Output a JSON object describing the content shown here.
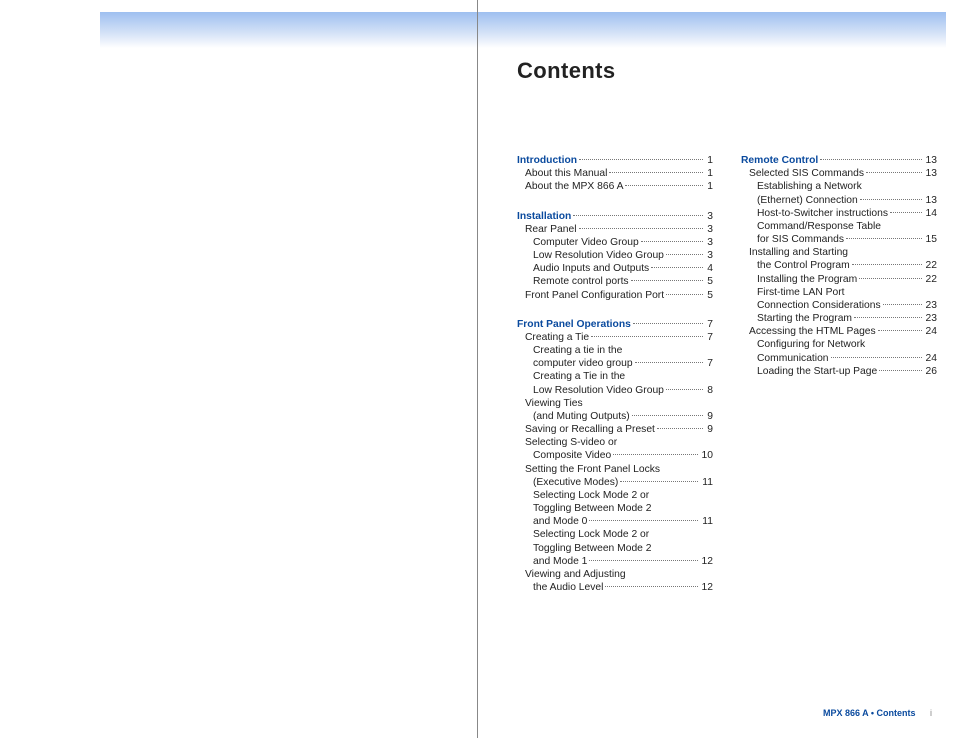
{
  "title": "Contents",
  "footer": {
    "doc": "MPX 866 A • Contents",
    "page": "i"
  },
  "toc": [
    {
      "col": 0,
      "sections": [
        {
          "head": {
            "label": "Introduction",
            "page": "1"
          },
          "items": [
            {
              "label": "About this Manual",
              "page": "1",
              "indent": 1
            },
            {
              "label": "About the MPX 866 A",
              "page": "1",
              "indent": 1
            }
          ]
        },
        {
          "head": {
            "label": "Installation",
            "page": "3"
          },
          "items": [
            {
              "label": "Rear Panel",
              "page": "3",
              "indent": 1
            },
            {
              "label": "Computer Video Group",
              "page": "3",
              "indent": 2
            },
            {
              "label": "Low Resolution Video Group",
              "page": "3",
              "indent": 2
            },
            {
              "label": "Audio Inputs and Outputs",
              "page": "4",
              "indent": 2
            },
            {
              "label": "Remote control ports",
              "page": "5",
              "indent": 2
            },
            {
              "label": "Front Panel Configuration Port",
              "page": "5",
              "indent": 1
            }
          ]
        },
        {
          "head": {
            "label": "Front Panel Operations",
            "page": "7"
          },
          "items": [
            {
              "label": "Creating a Tie",
              "page": "7",
              "indent": 1
            },
            {
              "label": "Creating a tie in the",
              "indent": 2
            },
            {
              "label": "computer video group",
              "page": "7",
              "indent": 2,
              "cont": true
            },
            {
              "label": "Creating a Tie in the",
              "indent": 2
            },
            {
              "label": "Low Resolution Video Group",
              "page": "8",
              "indent": 2,
              "cont": true
            },
            {
              "label": "Viewing Ties",
              "indent": 1
            },
            {
              "label": "(and Muting Outputs)",
              "page": "9",
              "indent": 2,
              "cont": true
            },
            {
              "label": "Saving or Recalling a Preset",
              "page": "9",
              "indent": 1
            },
            {
              "label": "Selecting S-video or",
              "indent": 1
            },
            {
              "label": "Composite Video",
              "page": "10",
              "indent": 2,
              "cont": true
            },
            {
              "label": "Setting the Front Panel Locks",
              "indent": 1
            },
            {
              "label": "(Executive Modes)",
              "page": "11",
              "indent": 2,
              "cont": true
            },
            {
              "label": "Selecting Lock Mode 2 or",
              "indent": 2
            },
            {
              "label": "Toggling Between Mode 2",
              "indent": 2,
              "cont": true
            },
            {
              "label": "and Mode 0",
              "page": "11",
              "indent": 2,
              "cont": true
            },
            {
              "label": "Selecting Lock Mode 2 or",
              "indent": 2
            },
            {
              "label": "Toggling Between Mode 2",
              "indent": 2,
              "cont": true
            },
            {
              "label": "and Mode 1",
              "page": "12",
              "indent": 2,
              "cont": true
            },
            {
              "label": "Viewing and Adjusting",
              "indent": 1
            },
            {
              "label": "the Audio Level",
              "page": "12",
              "indent": 2,
              "cont": true
            }
          ]
        }
      ]
    },
    {
      "col": 1,
      "sections": [
        {
          "head": {
            "label": "Remote Control",
            "page": "13"
          },
          "items": [
            {
              "label": "Selected SIS Commands",
              "page": "13",
              "indent": 1
            },
            {
              "label": "Establishing a Network",
              "indent": 2
            },
            {
              "label": "(Ethernet) Connection",
              "page": "13",
              "indent": 2,
              "cont": true
            },
            {
              "label": "Host-to-Switcher instructions",
              "page": "14",
              "indent": 2
            },
            {
              "label": "Command/Response Table",
              "indent": 2
            },
            {
              "label": "for SIS Commands",
              "page": "15",
              "indent": 2,
              "cont": true
            },
            {
              "label": "Installing and Starting",
              "indent": 1
            },
            {
              "label": "the Control Program",
              "page": "22",
              "indent": 2,
              "cont": true
            },
            {
              "label": "Installing the Program",
              "page": "22",
              "indent": 2
            },
            {
              "label": "First-time LAN Port",
              "indent": 2
            },
            {
              "label": "Connection Considerations",
              "page": "23",
              "indent": 2,
              "cont": true
            },
            {
              "label": "Starting the Program",
              "page": "23",
              "indent": 2
            },
            {
              "label": "Accessing the HTML Pages",
              "page": "24",
              "indent": 1
            },
            {
              "label": "Configuring for Network",
              "indent": 2
            },
            {
              "label": "Communication",
              "page": "24",
              "indent": 2,
              "cont": true
            },
            {
              "label": "Loading the Start-up Page",
              "page": "26",
              "indent": 2
            }
          ]
        }
      ]
    }
  ]
}
